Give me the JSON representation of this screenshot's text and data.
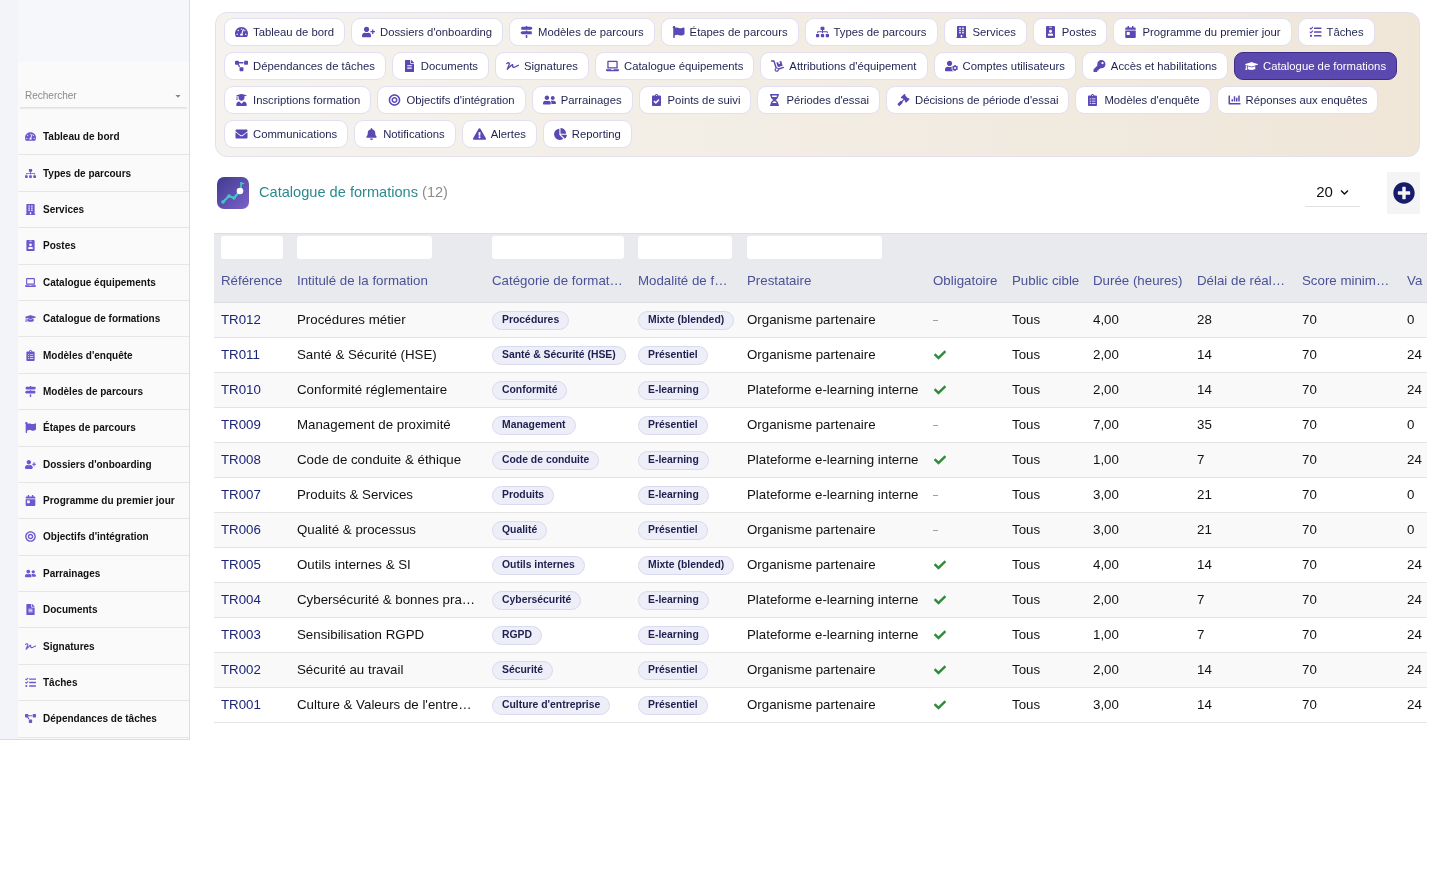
{
  "sidebar": {
    "search": {
      "placeholder": "Rechercher"
    },
    "items": [
      {
        "label": "Tableau de bord"
      },
      {
        "label": "Types de parcours"
      },
      {
        "label": "Services"
      },
      {
        "label": "Postes"
      },
      {
        "label": "Catalogue équipements"
      },
      {
        "label": "Catalogue de formations"
      },
      {
        "label": "Modèles d'enquête"
      },
      {
        "label": "Modèles de parcours"
      },
      {
        "label": "Étapes de parcours"
      },
      {
        "label": "Dossiers d'onboarding"
      },
      {
        "label": "Programme du premier jour"
      },
      {
        "label": "Objectifs d'intégration"
      },
      {
        "label": "Parrainages"
      },
      {
        "label": "Documents"
      },
      {
        "label": "Signatures"
      },
      {
        "label": "Tâches"
      },
      {
        "label": "Dépendances de tâches"
      }
    ]
  },
  "nav": {
    "items": [
      {
        "label": "Tableau de bord",
        "selected": false
      },
      {
        "label": "Dossiers d'onboarding",
        "selected": false
      },
      {
        "label": "Modèles de parcours",
        "selected": false
      },
      {
        "label": "Étapes de parcours",
        "selected": false
      },
      {
        "label": "Types de parcours",
        "selected": false
      },
      {
        "label": "Services",
        "selected": false
      },
      {
        "label": "Postes",
        "selected": false
      },
      {
        "label": "Programme du premier jour",
        "selected": false
      },
      {
        "label": "Tâches",
        "selected": false
      },
      {
        "label": "Dépendances de tâches",
        "selected": false
      },
      {
        "label": "Documents",
        "selected": false
      },
      {
        "label": "Signatures",
        "selected": false
      },
      {
        "label": "Catalogue équipements",
        "selected": false
      },
      {
        "label": "Attributions d'équipement",
        "selected": false
      },
      {
        "label": "Comptes utilisateurs",
        "selected": false
      },
      {
        "label": "Accès et habilitations",
        "selected": false
      },
      {
        "label": "Catalogue de formations",
        "selected": true
      },
      {
        "label": "Inscriptions formation",
        "selected": false
      },
      {
        "label": "Objectifs d'intégration",
        "selected": false
      },
      {
        "label": "Parrainages",
        "selected": false
      },
      {
        "label": "Points de suivi",
        "selected": false
      },
      {
        "label": "Périodes d'essai",
        "selected": false
      },
      {
        "label": "Décisions de période d'essai",
        "selected": false
      },
      {
        "label": "Modèles d'enquête",
        "selected": false
      },
      {
        "label": "Réponses aux enquêtes",
        "selected": false
      },
      {
        "label": "Communications",
        "selected": false
      },
      {
        "label": "Notifications",
        "selected": false
      },
      {
        "label": "Alertes",
        "selected": false
      },
      {
        "label": "Reporting",
        "selected": false
      }
    ]
  },
  "header": {
    "title": "Catalogue de formations",
    "count": "(12)",
    "page_size": "20"
  },
  "table": {
    "columns": [
      {
        "label": "Référence",
        "filter": true
      },
      {
        "label": "Intitulé de la formation",
        "filter": true
      },
      {
        "label": "Catégorie de format…",
        "filter": true
      },
      {
        "label": "Modalité de f…",
        "filter": true
      },
      {
        "label": "Prestataire",
        "filter": true
      },
      {
        "label": "Obligatoire",
        "filter": false
      },
      {
        "label": "Public cible",
        "filter": false
      },
      {
        "label": "Durée (heures)",
        "filter": false
      },
      {
        "label": "Délai de réal…",
        "filter": false
      },
      {
        "label": "Score minim…",
        "filter": false
      },
      {
        "label": "Va",
        "filter": false
      }
    ],
    "rows": [
      {
        "reference": "TR012",
        "title": "Procédures métier",
        "category": "Procédures",
        "modality": "Mixte (blended)",
        "provider": "Organisme partenaire",
        "mandatory": false,
        "audience": "Tous",
        "duration": "4,00",
        "delay": "28",
        "min_score": "70",
        "column_11": "0"
      },
      {
        "reference": "TR011",
        "title": "Santé & Sécurité (HSE)",
        "category": "Santé & Sécurité (HSE)",
        "modality": "Présentiel",
        "provider": "Organisme partenaire",
        "mandatory": true,
        "audience": "Tous",
        "duration": "2,00",
        "delay": "14",
        "min_score": "70",
        "column_11": "24"
      },
      {
        "reference": "TR010",
        "title": "Conformité réglementaire",
        "category": "Conformité",
        "modality": "E-learning",
        "provider": "Plateforme e-learning interne",
        "mandatory": true,
        "audience": "Tous",
        "duration": "2,00",
        "delay": "14",
        "min_score": "70",
        "column_11": "24"
      },
      {
        "reference": "TR009",
        "title": "Management de proximité",
        "category": "Management",
        "modality": "Présentiel",
        "provider": "Organisme partenaire",
        "mandatory": false,
        "audience": "Tous",
        "duration": "7,00",
        "delay": "35",
        "min_score": "70",
        "column_11": "0"
      },
      {
        "reference": "TR008",
        "title": "Code de conduite & éthique",
        "category": "Code de conduite",
        "modality": "E-learning",
        "provider": "Plateforme e-learning interne",
        "mandatory": true,
        "audience": "Tous",
        "duration": "1,00",
        "delay": "7",
        "min_score": "70",
        "column_11": "24"
      },
      {
        "reference": "TR007",
        "title": "Produits & Services",
        "category": "Produits",
        "modality": "E-learning",
        "provider": "Plateforme e-learning interne",
        "mandatory": false,
        "audience": "Tous",
        "duration": "3,00",
        "delay": "21",
        "min_score": "70",
        "column_11": "0"
      },
      {
        "reference": "TR006",
        "title": "Qualité & processus",
        "category": "Qualité",
        "modality": "Présentiel",
        "provider": "Organisme partenaire",
        "mandatory": false,
        "audience": "Tous",
        "duration": "3,00",
        "delay": "21",
        "min_score": "70",
        "column_11": "0"
      },
      {
        "reference": "TR005",
        "title": "Outils internes & SI",
        "category": "Outils internes",
        "modality": "Mixte (blended)",
        "provider": "Organisme partenaire",
        "mandatory": true,
        "audience": "Tous",
        "duration": "4,00",
        "delay": "14",
        "min_score": "70",
        "column_11": "24"
      },
      {
        "reference": "TR004",
        "title": "Cybersécurité & bonnes pra…",
        "category": "Cybersécurité",
        "modality": "E-learning",
        "provider": "Plateforme e-learning interne",
        "mandatory": true,
        "audience": "Tous",
        "duration": "2,00",
        "delay": "7",
        "min_score": "70",
        "column_11": "24"
      },
      {
        "reference": "TR003",
        "title": "Sensibilisation RGPD",
        "category": "RGPD",
        "modality": "E-learning",
        "provider": "Plateforme e-learning interne",
        "mandatory": true,
        "audience": "Tous",
        "duration": "1,00",
        "delay": "7",
        "min_score": "70",
        "column_11": "24"
      },
      {
        "reference": "TR002",
        "title": "Sécurité au travail",
        "category": "Sécurité",
        "modality": "Présentiel",
        "provider": "Organisme partenaire",
        "mandatory": true,
        "audience": "Tous",
        "duration": "2,00",
        "delay": "14",
        "min_score": "70",
        "column_11": "24"
      },
      {
        "reference": "TR001",
        "title": "Culture & Valeurs de l'entre…",
        "category": "Culture d'entreprise",
        "modality": "Présentiel",
        "provider": "Organisme partenaire",
        "mandatory": true,
        "audience": "Tous",
        "duration": "3,00",
        "delay": "14",
        "min_score": "70",
        "column_11": "24"
      }
    ]
  }
}
